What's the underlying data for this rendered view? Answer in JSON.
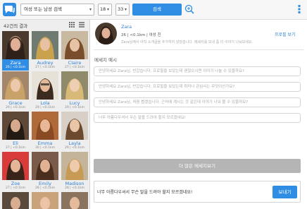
{
  "header": {
    "logo_icon": "chat-bubbles-logo",
    "gender_select": "여성 또는 남성 검색",
    "age_min": "18",
    "age_max": "33",
    "search_label": "검색",
    "zoom_icon": "zoom-in-icon",
    "menu_icon": "vertical-dots-icon"
  },
  "results": {
    "count_label": "42건의 결과",
    "view_icons": [
      "grid-view-icon",
      "list-view-icon"
    ],
    "members": [
      {
        "name": "Zara",
        "meta": "26 | <0.1km",
        "selected": true
      },
      {
        "name": "Audrey",
        "meta": "27 | <0.1km",
        "selected": false
      },
      {
        "name": "Claire",
        "meta": "27 | <0.1km",
        "selected": false
      },
      {
        "name": "Grace",
        "meta": "29 | <0.1km",
        "selected": false
      },
      {
        "name": "Lola",
        "meta": "29 | <0.1km",
        "selected": false
      },
      {
        "name": "Lucy",
        "meta": "29 | <0.1km",
        "selected": false
      },
      {
        "name": "Eli",
        "meta": "27 | <0.1km",
        "selected": false
      },
      {
        "name": "Emma",
        "meta": "30 | <0.1km",
        "selected": false
      },
      {
        "name": "Layla",
        "meta": "29 | <0.1km",
        "selected": false
      },
      {
        "name": "Zoe",
        "meta": "27 | <0.1km",
        "selected": false
      },
      {
        "name": "Emily",
        "meta": "28 | <0.1km",
        "selected": false
      },
      {
        "name": "Madison",
        "meta": "28 | <0.1km",
        "selected": false
      },
      {
        "name": "",
        "meta": "",
        "selected": false
      },
      {
        "name": "",
        "meta": "",
        "selected": false
      },
      {
        "name": "",
        "meta": "",
        "selected": false
      }
    ]
  },
  "profile": {
    "name": "Zara",
    "meta": "26 | <0.1km | 여성 친",
    "description": "Zara님께서 아직 소개글을 추가하지 않았습니다. 메세지를 보내 좀 더 이야기 나눠보세요.",
    "view_profile": "프로필 보기"
  },
  "messages": {
    "heading": "메세지 예시",
    "suggestions": [
      "안녕하세요 Zara님, 반갑습니다. 프로필을 보았는데 괜찮으시면 이야기 나눌 수 있을까요?",
      "안녕하세요 Zara님, 반갑습니다. 프로필을 보았는데 취미나 관심사는 무엇이신가요?",
      "안녕하세요 Zara님, 처음 뵙겠습니다. 근처에 계시는 것 같은데 이야기 나눠 볼 수 있을까요?",
      "너무 아름다우셔서 무슨 말을 드려야 할지 모르겠네요!"
    ],
    "more_label": "더 많은 메세지보기",
    "compose_text": "너무 아름다우셔서 무슨 말을 드려야 할지 모르겠네요!",
    "send_label": "보내기"
  },
  "colors": {
    "accent": "#2f8de4",
    "link": "#2f7fd2",
    "panel_bg": "#eeeeee",
    "more_button": "#b5b5b5"
  }
}
